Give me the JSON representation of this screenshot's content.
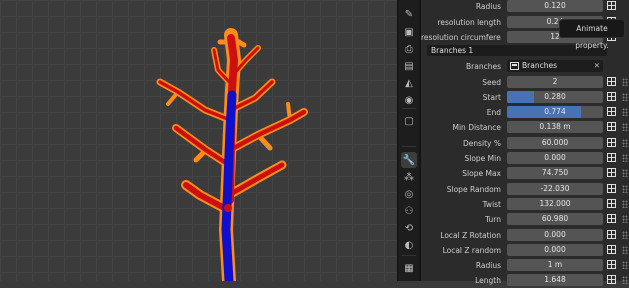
{
  "tooltip": "Animate property.",
  "name_field": "Branches 1",
  "datablock": {
    "label": "Branches",
    "value": "Branches"
  },
  "top_rows": [
    {
      "label": "Radius",
      "value": "0.120"
    },
    {
      "label": "resolution length",
      "value": "0.24"
    },
    {
      "label": "resolution circumfere...",
      "value": "12"
    }
  ],
  "rows": [
    {
      "label": "Seed",
      "value": "2"
    },
    {
      "label": "Start",
      "value": "0.280",
      "fill": 0.28
    },
    {
      "label": "End",
      "value": "0.774",
      "fill": 0.774
    },
    {
      "label": "Min Distance",
      "value": "0.138 m"
    },
    {
      "label": "Density %",
      "value": "60.000"
    },
    {
      "label": "Slope Min",
      "value": "0.000"
    },
    {
      "label": "Slope Max",
      "value": "74.750"
    },
    {
      "label": "Slope Random",
      "value": "-22.030"
    },
    {
      "label": "Twist",
      "value": "132.000"
    },
    {
      "label": "Turn",
      "value": "60.980"
    },
    {
      "label": "Local Z Rotation",
      "value": "0.000"
    },
    {
      "label": "Local Z  random",
      "value": "0.000"
    },
    {
      "label": "Radius",
      "value": "1 m"
    },
    {
      "label": "Length",
      "value": "1.648"
    }
  ],
  "tabs": [
    {
      "icon": "tool-icon",
      "glyph": "✎"
    },
    {
      "icon": "render-icon",
      "glyph": "▣"
    },
    {
      "icon": "output-icon",
      "glyph": "⎙"
    },
    {
      "icon": "view-layer-icon",
      "glyph": "▤"
    },
    {
      "icon": "scene-icon",
      "glyph": "◭"
    },
    {
      "icon": "world-icon",
      "glyph": "◉"
    },
    {
      "icon": "object-icon",
      "glyph": "▢"
    },
    {
      "icon": "modifiers-icon",
      "glyph": "🔧",
      "active": true
    },
    {
      "icon": "particles-icon",
      "glyph": "⁂"
    },
    {
      "icon": "physics-icon",
      "glyph": "◎"
    },
    {
      "icon": "constraints-icon",
      "glyph": "⚇"
    },
    {
      "icon": "data-icon",
      "glyph": "⟲"
    },
    {
      "icon": "material-icon",
      "glyph": "◐"
    },
    {
      "icon": "texture-icon",
      "glyph": "▦"
    }
  ],
  "colors": {
    "trunk": "#1010cc",
    "branch": "#cc1010",
    "outline": "#ff8c1a",
    "accent": "#4772b3"
  }
}
